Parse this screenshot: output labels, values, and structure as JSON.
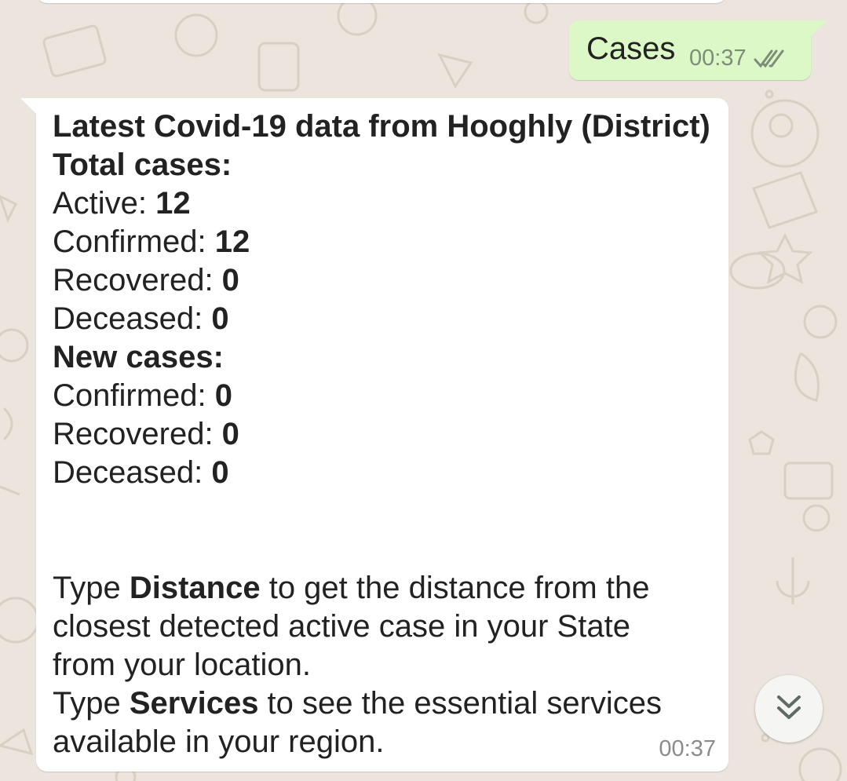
{
  "outgoing_message": {
    "text": "Cases",
    "time": "00:37",
    "status_icon": "double-check-icon"
  },
  "incoming_message": {
    "title": "Latest Covid-19 data from Hooghly (District)",
    "total_heading": "Total cases:",
    "total": {
      "active_label": "Active: ",
      "active_value": "12",
      "confirmed_label": "Confirmed: ",
      "confirmed_value": "12",
      "recovered_label": "Recovered: ",
      "recovered_value": "0",
      "deceased_label": "Deceased: ",
      "deceased_value": "0"
    },
    "new_heading": "New cases:",
    "new": {
      "confirmed_label": "Confirmed: ",
      "confirmed_value": "0",
      "recovered_label": "Recovered: ",
      "recovered_value": "0",
      "deceased_label": "Deceased: ",
      "deceased_value": "0"
    },
    "distance": {
      "pre": "Type ",
      "keyword": "Distance",
      "line1_rest": " to get the distance from the",
      "line2": "closest detected active case in your State",
      "line3": "from your location."
    },
    "services": {
      "pre": "Type ",
      "keyword": "Services",
      "line1_rest": " to see the essential services",
      "line2": "available in your region."
    },
    "time": "00:37"
  },
  "scroll_button": {
    "icon": "double-chevron-down-icon"
  },
  "colors": {
    "background": "#ece5dd",
    "outgoing_bubble": "#dcf8c6",
    "incoming_bubble": "#ffffff",
    "read_ticks": "#7d8d7a"
  }
}
